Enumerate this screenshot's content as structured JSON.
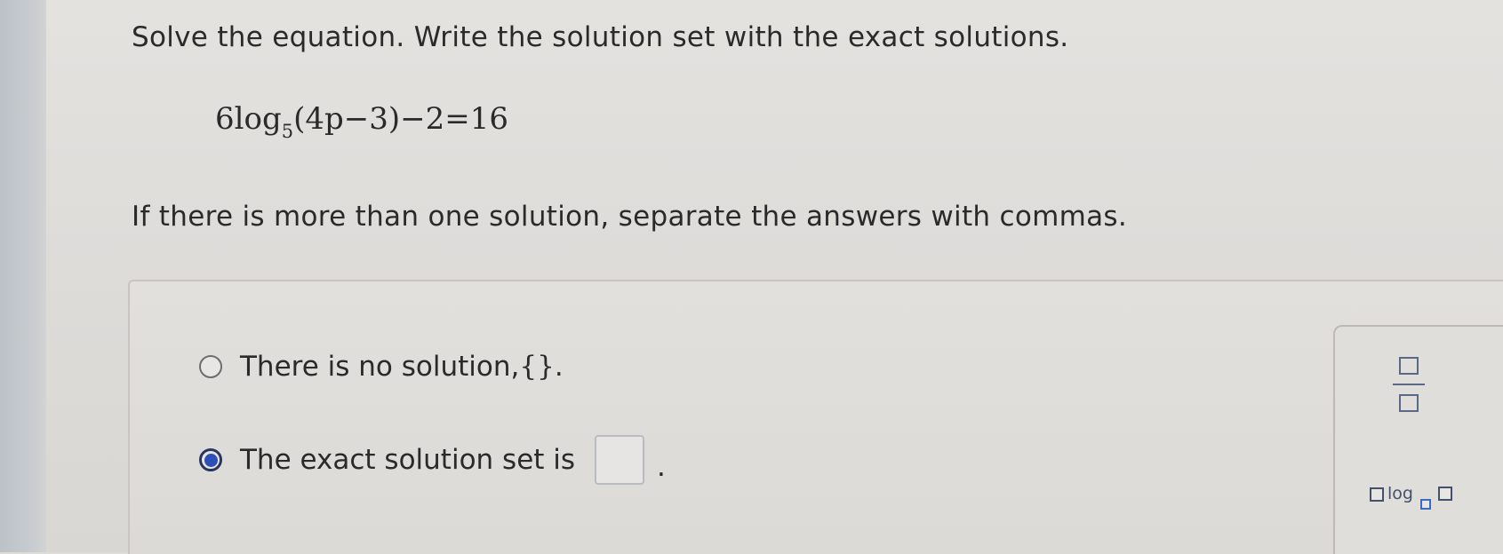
{
  "question": {
    "instruction": "Solve the equation. Write the solution set with the exact solutions.",
    "equation": {
      "coefficient": "6",
      "func": "log",
      "base": "5",
      "rest": "(4p−3)−2=16"
    },
    "hint": "If there is more than one solution, separate the answers with commas."
  },
  "answer": {
    "option_none_label": "There is no solution, ",
    "option_none_braces": "{}",
    "option_none_end": ".",
    "option_exact_label": "The exact solution set is",
    "option_exact_end": ".",
    "selected_option": "exact",
    "input_value": ""
  },
  "toolbox": {
    "log_label": "log",
    "tools": [
      "fraction-icon",
      "log-base-icon"
    ]
  },
  "colors": {
    "radio_selected": "#2f4fb8",
    "icon_stroke": "#5a6a86"
  }
}
